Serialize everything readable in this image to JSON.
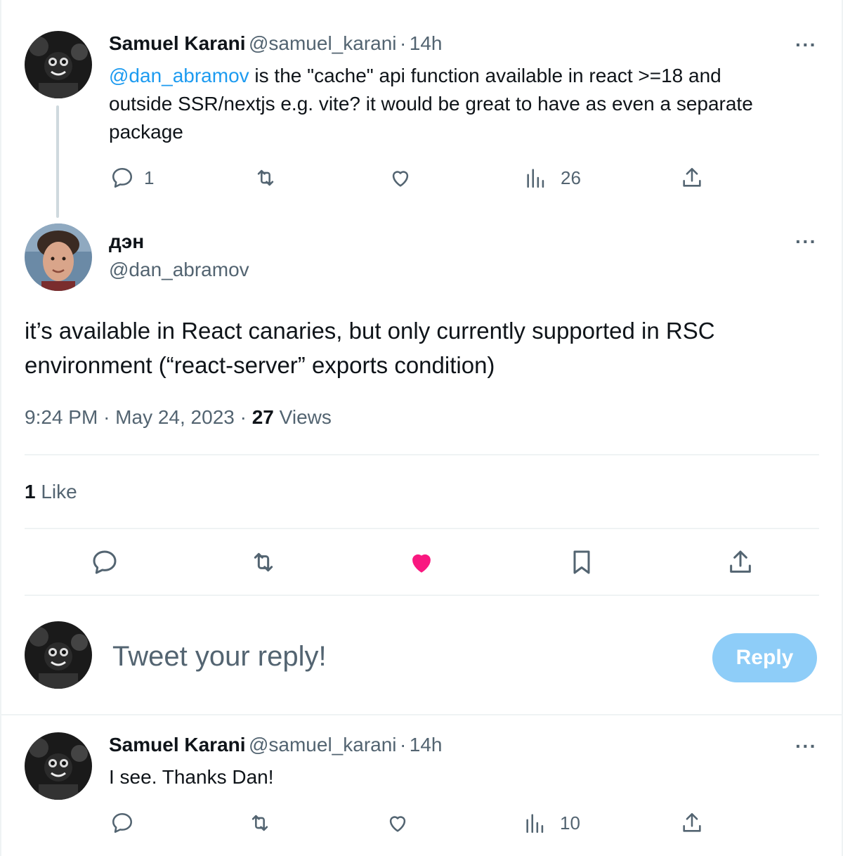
{
  "tweet1": {
    "name": "Samuel Karani",
    "handle": "@samuel_karani",
    "sep": "·",
    "time": "14h",
    "mention": "@dan_abramov",
    "text_line1": " is the \"cache\" api function available in react >=18 and",
    "text_line2": "outside SSR/nextjs e.g. vite? it would  be great to have as even a separate",
    "text_line3": "package",
    "reply_count": "1",
    "views_count": "26"
  },
  "main_tweet": {
    "name": "дэн",
    "handle": "@dan_abramov",
    "text_line1": "it’s available in React canaries, but only currently supported in RSC",
    "text_line2": "environment (“react-server” exports condition)",
    "time": "9:24 PM",
    "sep1": "·",
    "date": "May 24, 2023",
    "sep2": "·",
    "views_count": "27",
    "views_label": "Views",
    "likes_count": "1",
    "likes_label": "Like"
  },
  "composer": {
    "placeholder": "Tweet your reply!",
    "reply_label": "Reply"
  },
  "tweet3": {
    "name": "Samuel Karani",
    "handle": "@samuel_karani",
    "sep": "·",
    "time": "14h",
    "text": "I see. Thanks Dan!",
    "views_count": "10"
  },
  "more_label": "···",
  "colors": {
    "accent": "#1d9bf0",
    "like": "#f91880",
    "muted": "#536471",
    "reply_button_disabled": "#8ecdf8"
  },
  "icons": [
    "reply-icon",
    "retweet-icon",
    "like-icon",
    "views-icon",
    "share-icon",
    "bookmark-icon",
    "more-icon"
  ]
}
